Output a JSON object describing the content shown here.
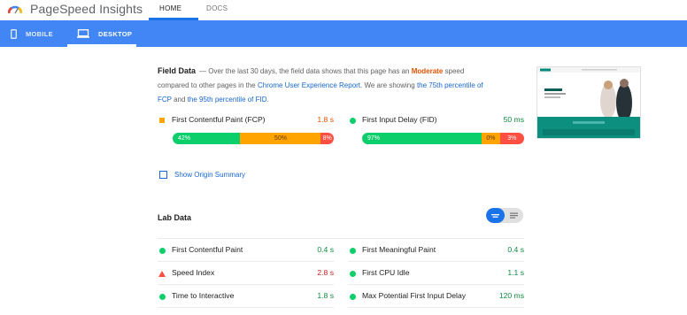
{
  "app": {
    "title": "PageSpeed Insights"
  },
  "nav": {
    "home": "HOME",
    "docs": "DOCS"
  },
  "devices": {
    "mobile": "MOBILE",
    "desktop": "DESKTOP"
  },
  "field": {
    "title": "Field Data",
    "desc_prefix": "— Over the last 30 days, the field data shows that this page has an",
    "speed": "Moderate",
    "desc_mid": "speed compared to other pages in the",
    "report_link": "Chrome User Experience Report",
    "desc_mid2": ". We are showing",
    "fcp_link": "the 75th percentile of FCP",
    "and": "and",
    "fid_link": "the 95th percentile of FID",
    "end": ".",
    "fcp": {
      "label": "First Contentful Paint (FCP)",
      "value": "1.8 s",
      "dist": [
        "42%",
        "50%",
        "8%"
      ],
      "fractions": [
        0.42,
        0.5,
        0.08
      ]
    },
    "fid": {
      "label": "First Input Delay (FID)",
      "value": "50 ms",
      "dist": [
        "97%",
        "0%",
        "3%"
      ],
      "fractions": [
        0.74,
        0.11,
        0.15
      ]
    }
  },
  "origin": {
    "label": "Show Origin Summary"
  },
  "lab": {
    "title": "Lab Data",
    "metrics": [
      {
        "label": "First Contentful Paint",
        "value": "0.4 s",
        "status": "pass"
      },
      {
        "label": "First Meaningful Paint",
        "value": "0.4 s",
        "status": "pass"
      },
      {
        "label": "Speed Index",
        "value": "2.8 s",
        "status": "fail"
      },
      {
        "label": "First CPU Idle",
        "value": "1.1 s",
        "status": "pass"
      },
      {
        "label": "Time to Interactive",
        "value": "1.8 s",
        "status": "pass"
      },
      {
        "label": "Max Potential First Input Delay",
        "value": "120 ms",
        "status": "pass"
      }
    ]
  },
  "colors": {
    "accent": "#4285f4",
    "good": "#0cce6b",
    "average": "#ffa400",
    "poor": "#ff4e42"
  }
}
